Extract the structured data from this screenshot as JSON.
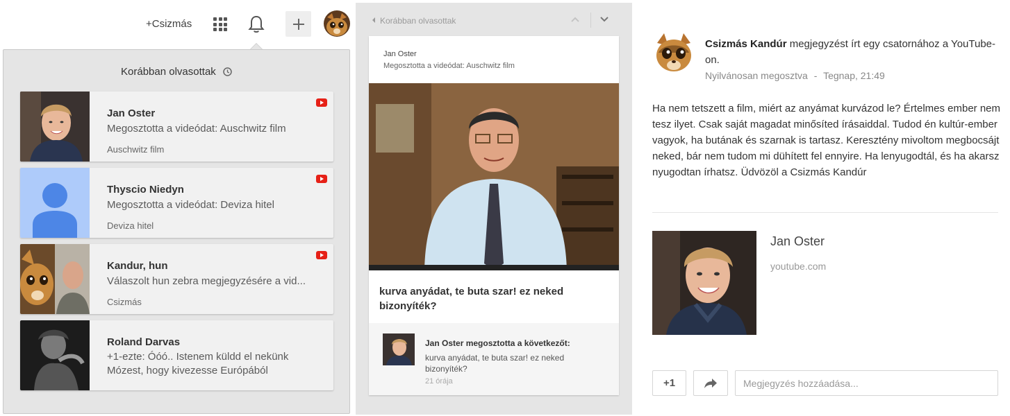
{
  "topbar": {
    "plus_name": "+Csizmás"
  },
  "notifications": {
    "title": "Korábban olvasottak",
    "items": [
      {
        "name": "Jan Oster",
        "line": "Megosztotta a videódat: Auschwitz film",
        "sub": "Auschwitz film"
      },
      {
        "name": "Thyscio Niedyn",
        "line": "Megosztotta a videódat: Deviza hitel",
        "sub": "Deviza hitel"
      },
      {
        "name": "Kandur, hun",
        "line": "Válaszolt hun zebra megjegyzésére a vid...",
        "sub": "Csizmás"
      },
      {
        "name": "Roland Darvas",
        "line": "+1-ezte: Óóó.. Istenem küldd el nekünk Mózest, hogy kivezesse Európából"
      }
    ]
  },
  "detail": {
    "back_label": "Korábban olvasottak",
    "header_name": "Jan Oster",
    "header_sub": "Megosztotta a videódat: Auschwitz film",
    "caption": "kurva anyádat, te buta szar! ez neked bizonyíték?",
    "footer": {
      "title": "Jan Oster megosztotta a következőt:",
      "text": "kurva anyádat, te buta szar! ez neked bizonyíték?",
      "time": "21 órája"
    }
  },
  "post": {
    "author": "Csizmás Kandúr",
    "headline_rest": " megjegyzést írt egy csatornához a YouTube-on.",
    "visibility": "Nyilvánosan megosztva",
    "separator": "-",
    "timestamp": "Tegnap, 21:49",
    "body": "Ha nem tetszett a film, miért az anyámat kurvázod le? Értelmes ember nem tesz ilyet. Csak saját magadat minősíted írásaiddal. Tudod én kultúr-ember vagyok, ha butának és szarnak is tartasz. Keresztény mivoltom megbocsájt neked, bár nem tudom mi dühített fel ennyire. Ha lenyugodtál, és ha akarsz nyugodtan írhatsz. Üdvözöl a Csizmás Kandúr",
    "link_title": "Jan Oster",
    "link_domain": "youtube.com",
    "plusone_label": "+1",
    "comment_placeholder": "Megjegyzés hozzáadása..."
  },
  "colors": {
    "panel_gray": "#e5e5e5",
    "card_bg": "#f1f1f1",
    "youtube_red": "#e62117",
    "placeholder_blue": "#aecbfa",
    "silhouette_blue": "#4d86e6"
  },
  "icons": [
    "apps-grid-icon",
    "bell-icon",
    "plus-icon",
    "clock-icon",
    "youtube-icon",
    "chevron-up-icon",
    "chevron-down-icon",
    "share-arrow-icon",
    "back-triangle-icon"
  ]
}
